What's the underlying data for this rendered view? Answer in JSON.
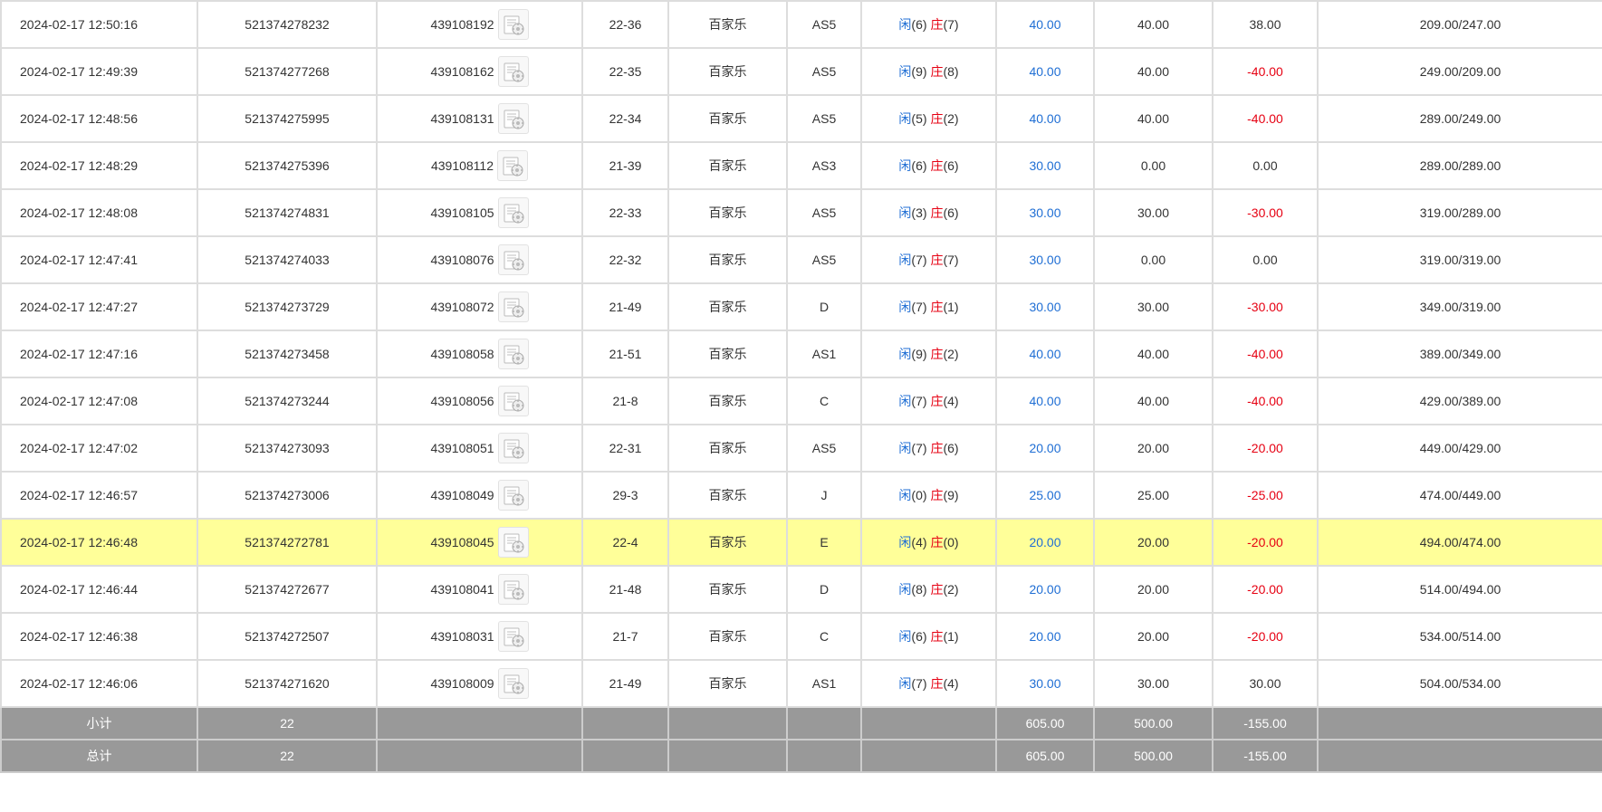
{
  "colors": {
    "highlight": "#ffff99",
    "positive_blue": "#1f6ed4",
    "negative_red": "#e60012",
    "summary_bg": "#999999"
  },
  "labels": {
    "player": "闲",
    "banker": "庄"
  },
  "rows": [
    {
      "time": "2024-02-17 12:50:16",
      "order": "521374278232",
      "shoe": "439108192",
      "table": "22-36",
      "game": "百家乐",
      "seat": "AS5",
      "player": "(6)",
      "banker": "(7)",
      "bet": "40.00",
      "valid": "40.00",
      "win": "38.00",
      "balance": "209.00/247.00"
    },
    {
      "time": "2024-02-17 12:49:39",
      "order": "521374277268",
      "shoe": "439108162",
      "table": "22-35",
      "game": "百家乐",
      "seat": "AS5",
      "player": "(9)",
      "banker": "(8)",
      "bet": "40.00",
      "valid": "40.00",
      "win": "-40.00",
      "balance": "249.00/209.00"
    },
    {
      "time": "2024-02-17 12:48:56",
      "order": "521374275995",
      "shoe": "439108131",
      "table": "22-34",
      "game": "百家乐",
      "seat": "AS5",
      "player": "(5)",
      "banker": "(2)",
      "bet": "40.00",
      "valid": "40.00",
      "win": "-40.00",
      "balance": "289.00/249.00"
    },
    {
      "time": "2024-02-17 12:48:29",
      "order": "521374275396",
      "shoe": "439108112",
      "table": "21-39",
      "game": "百家乐",
      "seat": "AS3",
      "player": "(6)",
      "banker": "(6)",
      "bet": "30.00",
      "valid": "0.00",
      "win": "0.00",
      "balance": "289.00/289.00"
    },
    {
      "time": "2024-02-17 12:48:08",
      "order": "521374274831",
      "shoe": "439108105",
      "table": "22-33",
      "game": "百家乐",
      "seat": "AS5",
      "player": "(3)",
      "banker": "(6)",
      "bet": "30.00",
      "valid": "30.00",
      "win": "-30.00",
      "balance": "319.00/289.00"
    },
    {
      "time": "2024-02-17 12:47:41",
      "order": "521374274033",
      "shoe": "439108076",
      "table": "22-32",
      "game": "百家乐",
      "seat": "AS5",
      "player": "(7)",
      "banker": "(7)",
      "bet": "30.00",
      "valid": "0.00",
      "win": "0.00",
      "balance": "319.00/319.00"
    },
    {
      "time": "2024-02-17 12:47:27",
      "order": "521374273729",
      "shoe": "439108072",
      "table": "21-49",
      "game": "百家乐",
      "seat": "D",
      "player": "(7)",
      "banker": "(1)",
      "bet": "30.00",
      "valid": "30.00",
      "win": "-30.00",
      "balance": "349.00/319.00"
    },
    {
      "time": "2024-02-17 12:47:16",
      "order": "521374273458",
      "shoe": "439108058",
      "table": "21-51",
      "game": "百家乐",
      "seat": "AS1",
      "player": "(9)",
      "banker": "(2)",
      "bet": "40.00",
      "valid": "40.00",
      "win": "-40.00",
      "balance": "389.00/349.00"
    },
    {
      "time": "2024-02-17 12:47:08",
      "order": "521374273244",
      "shoe": "439108056",
      "table": "21-8",
      "game": "百家乐",
      "seat": "C",
      "player": "(7)",
      "banker": "(4)",
      "bet": "40.00",
      "valid": "40.00",
      "win": "-40.00",
      "balance": "429.00/389.00"
    },
    {
      "time": "2024-02-17 12:47:02",
      "order": "521374273093",
      "shoe": "439108051",
      "table": "22-31",
      "game": "百家乐",
      "seat": "AS5",
      "player": "(7)",
      "banker": "(6)",
      "bet": "20.00",
      "valid": "20.00",
      "win": "-20.00",
      "balance": "449.00/429.00"
    },
    {
      "time": "2024-02-17 12:46:57",
      "order": "521374273006",
      "shoe": "439108049",
      "table": "29-3",
      "game": "百家乐",
      "seat": "J",
      "player": "(0)",
      "banker": "(9)",
      "bet": "25.00",
      "valid": "25.00",
      "win": "-25.00",
      "balance": "474.00/449.00"
    },
    {
      "time": "2024-02-17 12:46:48",
      "order": "521374272781",
      "shoe": "439108045",
      "table": "22-4",
      "game": "百家乐",
      "seat": "E",
      "player": "(4)",
      "banker": "(0)",
      "bet": "20.00",
      "valid": "20.00",
      "win": "-20.00",
      "balance": "494.00/474.00",
      "highlight": true
    },
    {
      "time": "2024-02-17 12:46:44",
      "order": "521374272677",
      "shoe": "439108041",
      "table": "21-48",
      "game": "百家乐",
      "seat": "D",
      "player": "(8)",
      "banker": "(2)",
      "bet": "20.00",
      "valid": "20.00",
      "win": "-20.00",
      "balance": "514.00/494.00"
    },
    {
      "time": "2024-02-17 12:46:38",
      "order": "521374272507",
      "shoe": "439108031",
      "table": "21-7",
      "game": "百家乐",
      "seat": "C",
      "player": "(6)",
      "banker": "(1)",
      "bet": "20.00",
      "valid": "20.00",
      "win": "-20.00",
      "balance": "534.00/514.00"
    },
    {
      "time": "2024-02-17 12:46:06",
      "order": "521374271620",
      "shoe": "439108009",
      "table": "21-49",
      "game": "百家乐",
      "seat": "AS1",
      "player": "(7)",
      "banker": "(4)",
      "bet": "30.00",
      "valid": "30.00",
      "win": "30.00",
      "balance": "504.00/534.00"
    }
  ],
  "subtotal": {
    "label": "小计",
    "count": "22",
    "bet": "605.00",
    "valid": "500.00",
    "win": "-155.00"
  },
  "total": {
    "label": "总计",
    "count": "22",
    "bet": "605.00",
    "valid": "500.00",
    "win": "-155.00"
  }
}
